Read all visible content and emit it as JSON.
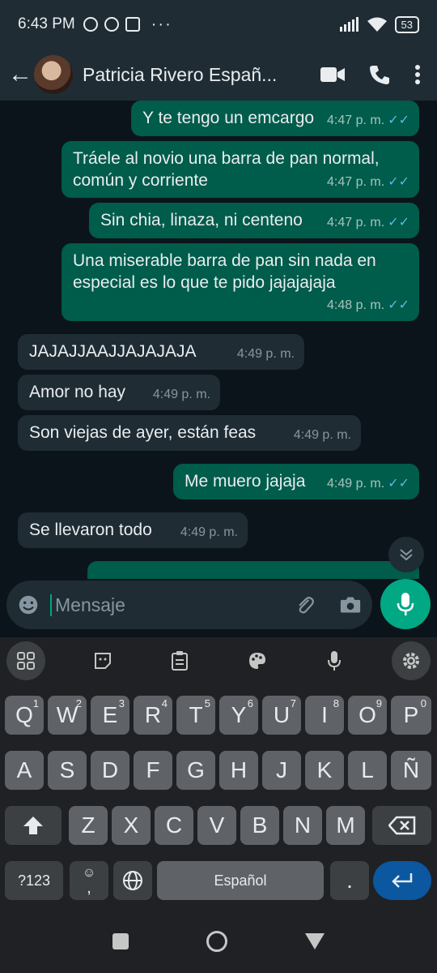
{
  "status": {
    "time": "6:43 PM",
    "battery": "53",
    "more": "···"
  },
  "header": {
    "contact_name": "Patricia Rivero Españ..."
  },
  "messages": [
    {
      "dir": "out",
      "text": "Y te tengo un emcargo",
      "time": "4:47 p. m."
    },
    {
      "dir": "out",
      "text": "Tráele al novio una barra de pan normal, común y corriente",
      "time": "4:47 p. m."
    },
    {
      "dir": "out",
      "text": "Sin chia, linaza, ni centeno",
      "time": "4:47 p. m."
    },
    {
      "dir": "out",
      "text": "Una miserable barra de pan sin nada en especial es lo que te pido jajajajaja",
      "time": "4:48 p. m."
    },
    {
      "dir": "in",
      "text": "JAJAJJAAJJAJAJAJA",
      "time": "4:49 p. m."
    },
    {
      "dir": "in",
      "text": "Amor no hay",
      "time": "4:49 p. m."
    },
    {
      "dir": "in",
      "text": "Son viejas de ayer,  están feas",
      "time": "4:49 p. m."
    },
    {
      "dir": "out",
      "text": "Me muero jajaja",
      "time": "4:49 p. m."
    },
    {
      "dir": "in",
      "text": "Se llevaron todo",
      "time": "4:49 p. m."
    }
  ],
  "input": {
    "placeholder": "Mensaje"
  },
  "keyboard": {
    "row1": [
      {
        "k": "Q",
        "h": "1"
      },
      {
        "k": "W",
        "h": "2"
      },
      {
        "k": "E",
        "h": "3"
      },
      {
        "k": "R",
        "h": "4"
      },
      {
        "k": "T",
        "h": "5"
      },
      {
        "k": "Y",
        "h": "6"
      },
      {
        "k": "U",
        "h": "7"
      },
      {
        "k": "I",
        "h": "8"
      },
      {
        "k": "O",
        "h": "9"
      },
      {
        "k": "P",
        "h": "0"
      }
    ],
    "row2": [
      "A",
      "S",
      "D",
      "F",
      "G",
      "H",
      "J",
      "K",
      "L",
      "Ñ"
    ],
    "row3": [
      "Z",
      "X",
      "C",
      "V",
      "B",
      "N",
      "M"
    ],
    "symbols_label": "?123",
    "space_label": "Español",
    "period_label": ".",
    "comma_label": ",",
    "emoji_hint": "☺"
  },
  "colors": {
    "outgoing_bubble": "#005c4b",
    "incoming_bubble": "#1f2c34",
    "accent": "#00a884",
    "read_ticks": "#53bdeb"
  }
}
